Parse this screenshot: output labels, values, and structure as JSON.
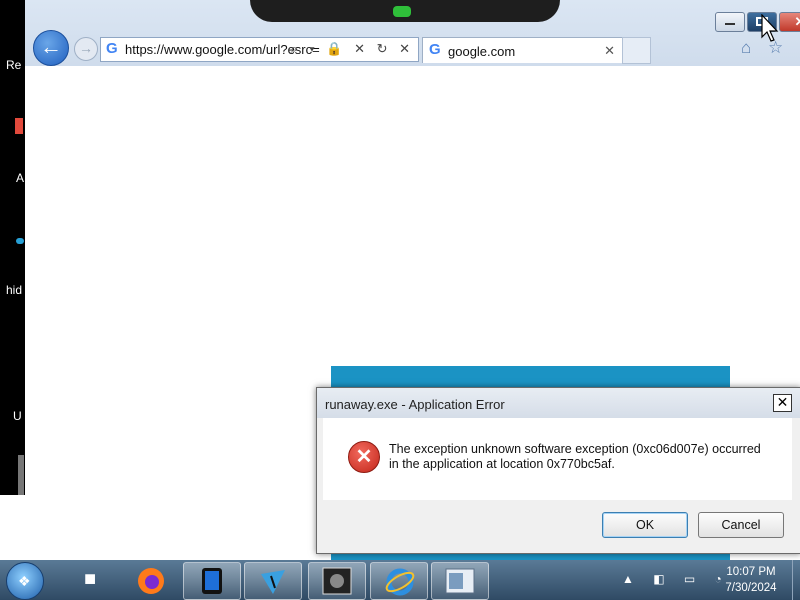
{
  "desktop": {
    "left_labels": [
      "Re",
      "A",
      "hid",
      "U"
    ]
  },
  "browser": {
    "address": "https://www.google.com/url?esrc=",
    "address_icons": "⌕ ▾ 🔒 ✕ ↻ ✕",
    "tab_title": "google.com",
    "tab_close": "✕",
    "window_close_glyph": "✕",
    "toolbar_icons": "⌂ ☆ ⚙",
    "favicon_letter": "G"
  },
  "dialog": {
    "title": "runaway.exe - Application Error",
    "close_glyph": "✕",
    "message": "The exception unknown software exception (0xc06d007e) occurred in the application at location 0x770bc5af.",
    "ok_label": "OK",
    "cancel_label": "Cancel",
    "icon": "error-icon",
    "icon_glyph": "✕"
  },
  "taskbar": {
    "apps": [
      "file-explorer-icon",
      "firefox-icon",
      "tablet-app-icon",
      "tool-app-icon",
      "security-app-icon",
      "internet-explorer-icon",
      "window-app-icon"
    ],
    "tray_icons": "▲ ◧ ▭ ◔",
    "time": "10:07 PM",
    "date": "7/30/2024"
  }
}
